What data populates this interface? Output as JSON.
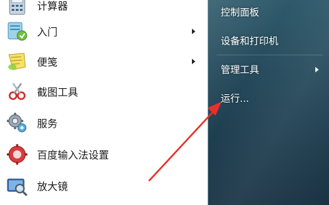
{
  "left_menu": {
    "items": [
      {
        "label": "计算器",
        "icon": "calculator-icon",
        "has_submenu": false
      },
      {
        "label": "入门",
        "icon": "getting-started-icon",
        "has_submenu": true
      },
      {
        "label": "便笺",
        "icon": "sticky-notes-icon",
        "has_submenu": true
      },
      {
        "label": "截图工具",
        "icon": "snipping-tool-icon",
        "has_submenu": false
      },
      {
        "label": "服务",
        "icon": "services-gear-icon",
        "has_submenu": false
      },
      {
        "label": "百度输入法设置",
        "icon": "baidu-ime-settings-icon",
        "has_submenu": false
      },
      {
        "label": "放大镜",
        "icon": "magnifier-icon",
        "has_submenu": false
      }
    ]
  },
  "right_menu": {
    "items": [
      {
        "label": "控制面板",
        "has_submenu": false
      },
      {
        "label": "设备和打印机",
        "has_submenu": false
      },
      {
        "label": "管理工具",
        "has_submenu": true
      },
      {
        "label": "运行...",
        "has_submenu": false
      }
    ]
  },
  "colors": {
    "right_pane": "#24485a",
    "annotation_arrow": "#e8302a"
  }
}
